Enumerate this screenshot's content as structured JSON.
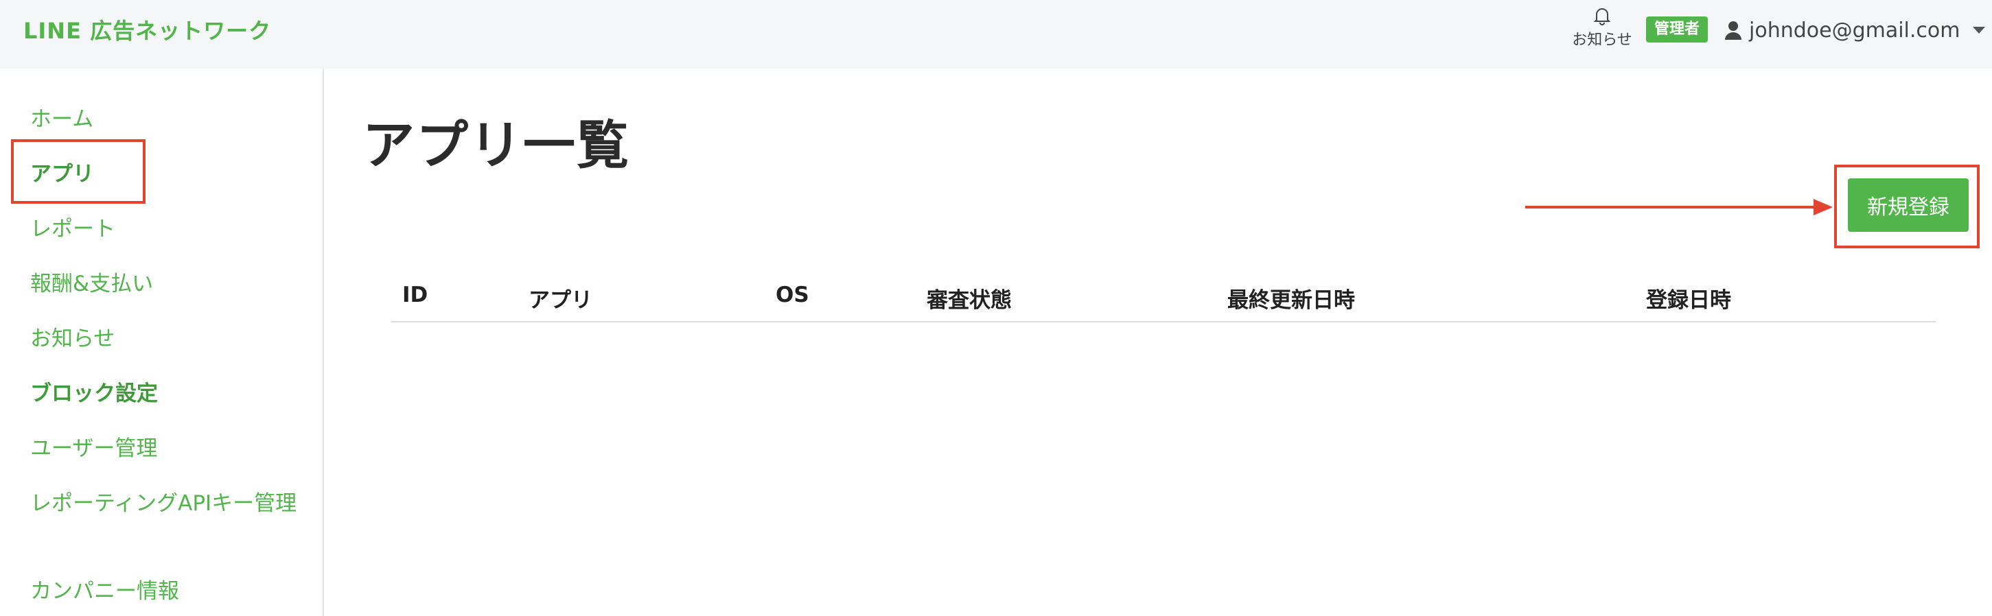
{
  "app": {
    "logo": "LINE 広告ネットワーク"
  },
  "header": {
    "notice_label": "お知らせ",
    "role_badge": "管理者",
    "user_email": "johndoe@gmail.com"
  },
  "sidebar": {
    "items": [
      {
        "label": "ホーム"
      },
      {
        "label": "アプリ"
      },
      {
        "label": "レポート"
      },
      {
        "label": "報酬&支払い"
      },
      {
        "label": "お知らせ"
      },
      {
        "label": "ブロック設定"
      },
      {
        "label": "ユーザー管理"
      },
      {
        "label": "レポーティングAPIキー管理"
      },
      {
        "label": "カンパニー情報"
      }
    ]
  },
  "main": {
    "title": "アプリ一覧",
    "new_button": "新規登録",
    "table": {
      "columns": [
        "ID",
        "アプリ",
        "OS",
        "審査状態",
        "最終更新日時",
        "登録日時"
      ],
      "rows": []
    }
  },
  "colors": {
    "brand_green": "#52b54b",
    "annotation_red": "#e2442f"
  }
}
